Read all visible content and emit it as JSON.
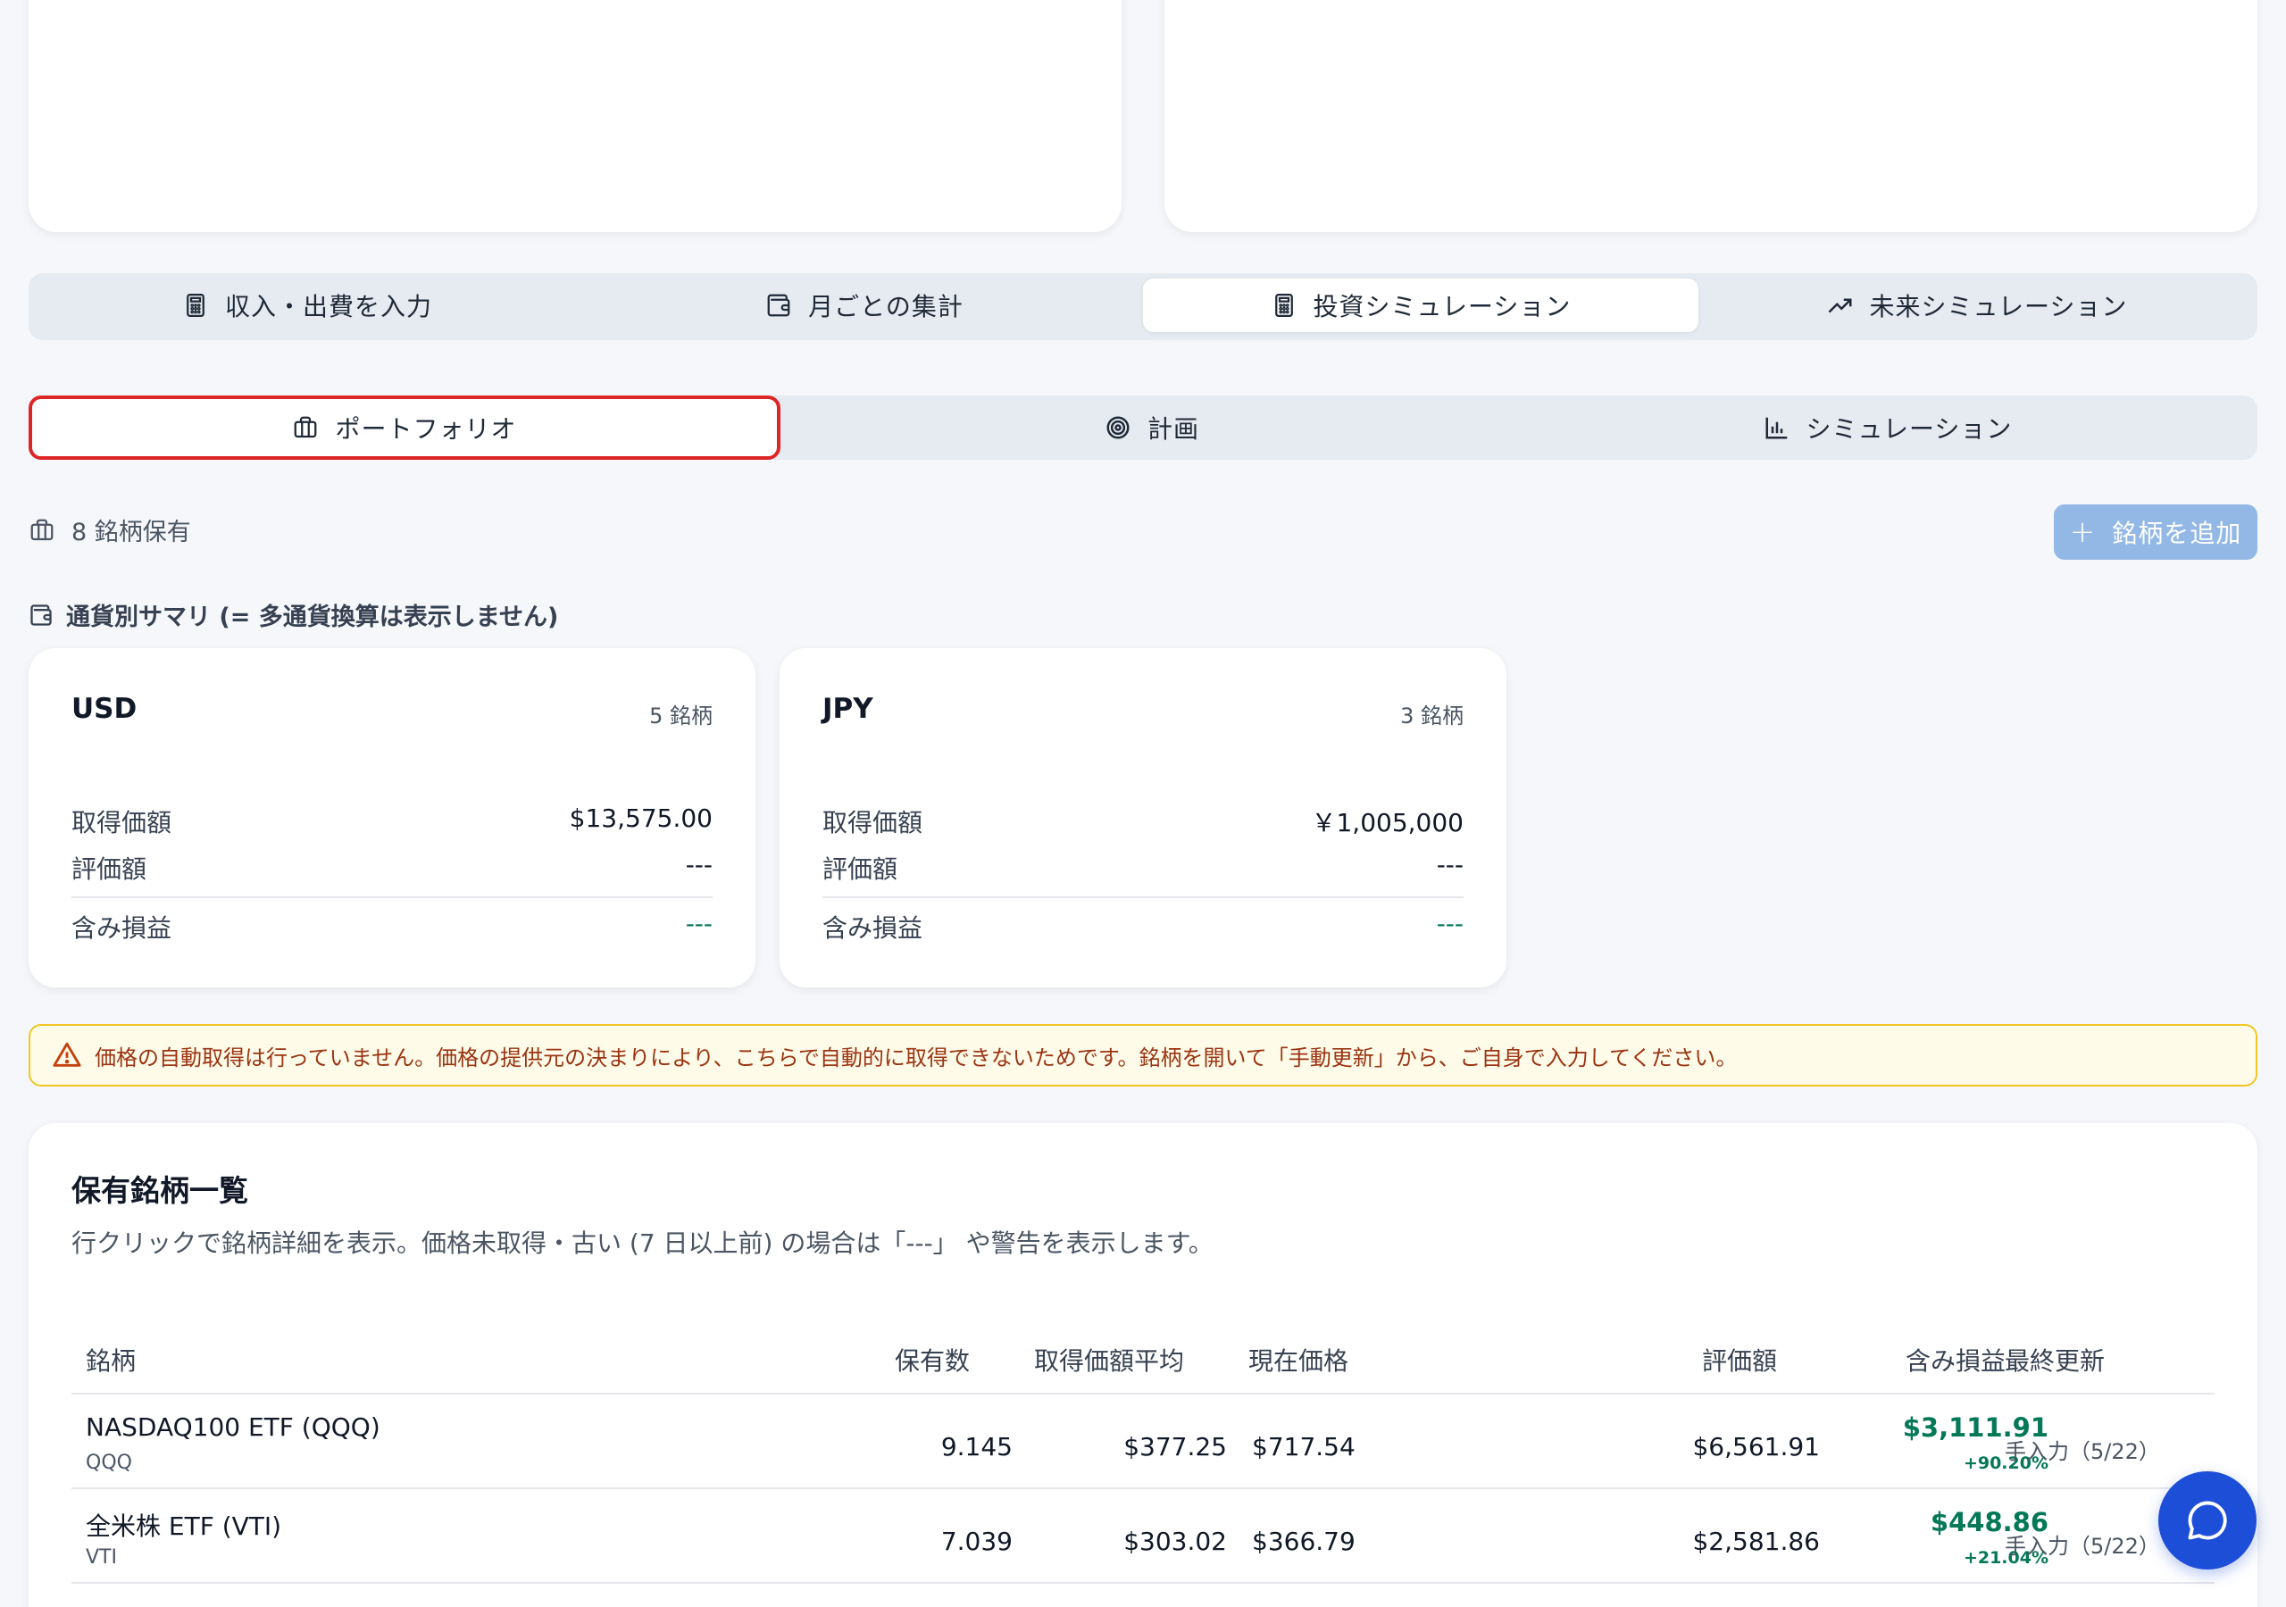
{
  "main_tabs": [
    {
      "label": "収入・出費を入力",
      "icon": "calculator-icon"
    },
    {
      "label": "月ごとの集計",
      "icon": "wallet-icon"
    },
    {
      "label": "投資シミュレーション",
      "icon": "calculator-icon",
      "active": true
    },
    {
      "label": "未来シミュレーション",
      "icon": "trending-up-icon"
    }
  ],
  "sub_tabs": [
    {
      "label": "ポートフォリオ",
      "icon": "briefcase-icon",
      "active": true
    },
    {
      "label": "計画",
      "icon": "target-icon"
    },
    {
      "label": "シミュレーション",
      "icon": "bar-chart-icon"
    }
  ],
  "holdings_count": "8 銘柄保有",
  "add_button": {
    "plus": "+",
    "label": "銘柄を追加"
  },
  "currency_summary_title": "通貨別サマリ (= 多通貨換算は表示しません)",
  "currency_cards": [
    {
      "code": "USD",
      "count": "5 銘柄",
      "rows": [
        {
          "label": "取得価額",
          "value": "$13,575.00"
        },
        {
          "label": "評価額",
          "value": "---"
        },
        {
          "label": "含み損益",
          "value": "---"
        }
      ]
    },
    {
      "code": "JPY",
      "count": "3 銘柄",
      "rows": [
        {
          "label": "取得価額",
          "value": "￥1,005,000"
        },
        {
          "label": "評価額",
          "value": "---"
        },
        {
          "label": "含み損益",
          "value": "---"
        }
      ]
    }
  ],
  "warning_text": "価格の自動取得は行っていません。価格の提供元の決まりにより、こちらで自動的に取得できないためです。銘柄を開いて「手動更新」から、ご自身で入力してください。",
  "holdings": {
    "title": "保有銘柄一覧",
    "description": "行クリックで銘柄詳細を表示。価格未取得・古い (7 日以上前) の場合は「---」 や警告を表示します。",
    "columns": [
      "銘柄",
      "保有数",
      "取得価額平均",
      "現在価格",
      "評価額",
      "含み損益",
      "最終更新"
    ],
    "rows": [
      {
        "name": "NASDAQ100 ETF (QQQ)",
        "ticker": "QQQ",
        "quantity": "9.145",
        "avg_cost": "$377.25",
        "price": "$717.54",
        "value": "$6,561.91",
        "pl": "$3,111.91",
        "pl_pct": "+90.20%",
        "updated": "手入力（5/22）"
      },
      {
        "name": "全米株 ETF (VTI)",
        "ticker": "VTI",
        "quantity": "7.039",
        "avg_cost": "$303.02",
        "price": "$366.79",
        "value": "$2,581.86",
        "pl": "$448.86",
        "pl_pct": "+21.04%",
        "updated": "手入力（5/22）"
      }
    ]
  },
  "colors": {
    "accent": "#1d4ed8",
    "positive": "#047857",
    "warning_bg": "#fefbe8",
    "warning_border": "#f3c623",
    "focus_outline": "#dc2626"
  }
}
